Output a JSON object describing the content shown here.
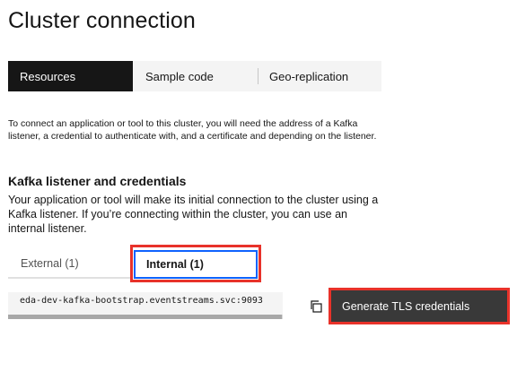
{
  "page": {
    "title": "Cluster connection"
  },
  "tabs": [
    {
      "label": "Resources",
      "active": true
    },
    {
      "label": "Sample code",
      "active": false
    },
    {
      "label": "Geo-replication",
      "active": false
    }
  ],
  "intro": "To connect an application or tool to this cluster, you will need the address of a Kafka listener, a credential to authenticate with, and a certificate and depending on the listener.",
  "section": {
    "title": "Kafka listener and credentials",
    "description": "Your application or tool will make its initial connection to the cluster using a Kafka listener. If you’re connecting within the cluster, you can use an internal listener."
  },
  "listener_tabs": [
    {
      "label": "External (1)",
      "active": false
    },
    {
      "label": "Internal (1)",
      "active": true
    }
  ],
  "bootstrap_address": "eda-dev-kafka-bootstrap.eventstreams.svc:9093",
  "buttons": {
    "generate_tls": "Generate TLS credentials"
  },
  "icons": {
    "copy": "copy-icon"
  },
  "colors": {
    "active_tab_bg": "#161616",
    "focus_border": "#0f62fe",
    "highlight": "#e8322a",
    "primary_button_bg": "#393939"
  }
}
